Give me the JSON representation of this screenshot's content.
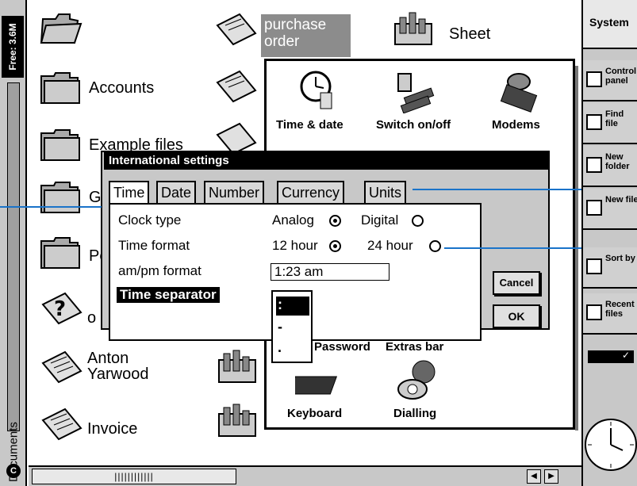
{
  "status": {
    "free_space": "Free: 3.6M",
    "group_label": "Documents"
  },
  "desktop": {
    "folders": [
      {
        "label": "Accounts"
      },
      {
        "label": "Example files"
      },
      {
        "label": "Games"
      },
      {
        "label": "Personal"
      }
    ],
    "documents": [
      {
        "label": "o"
      },
      {
        "label": "Anton\nYarwood"
      },
      {
        "label": "Invoice"
      }
    ],
    "purchase_order_label": "purchase order",
    "sheet_label": "Sheet"
  },
  "control_panel": {
    "items": [
      {
        "label": "Time & date",
        "icon": "clock-icon"
      },
      {
        "label": "Switch on/off",
        "icon": "batteries-icon"
      },
      {
        "label": "Modems",
        "icon": "modem-icon"
      },
      {
        "label": "Password",
        "icon": "password-icon"
      },
      {
        "label": "Extras bar",
        "icon": "extras-icon"
      },
      {
        "label": "Keyboard",
        "icon": "keyboard-icon"
      },
      {
        "label": "Dialling",
        "icon": "phone-icon"
      }
    ]
  },
  "dialog": {
    "title": "International settings",
    "tabs": [
      "Time",
      "Date",
      "Number",
      "Currency",
      "Units"
    ],
    "active_tab": "Time",
    "clock_type": {
      "label": "Clock type",
      "option_a": "Analog",
      "option_b": "Digital",
      "selected": "Analog"
    },
    "time_format": {
      "label": "Time format",
      "option_a": "12 hour",
      "option_b": "24 hour",
      "selected": "12 hour"
    },
    "ampm_format": {
      "label": "am/pm format",
      "value": "1:23 am"
    },
    "time_separator": {
      "label": "Time separator",
      "options": [
        ":",
        "-",
        "."
      ],
      "selected": ":"
    },
    "cancel_label": "Cancel",
    "ok_label": "OK"
  },
  "sidebar": {
    "system_label": "System",
    "items": [
      {
        "label": "Control panel"
      },
      {
        "label": "Find file"
      },
      {
        "label": "New folder"
      },
      {
        "label": "New file"
      },
      {
        "label": "Sort by"
      },
      {
        "label": "Recent files"
      }
    ]
  },
  "bottom_bar": {
    "scroll_label": "||||||||||||"
  },
  "colors": {
    "callout": "#1a73c9",
    "dialog_title_bg": "#000000",
    "highlight": "#8c8c8c"
  }
}
